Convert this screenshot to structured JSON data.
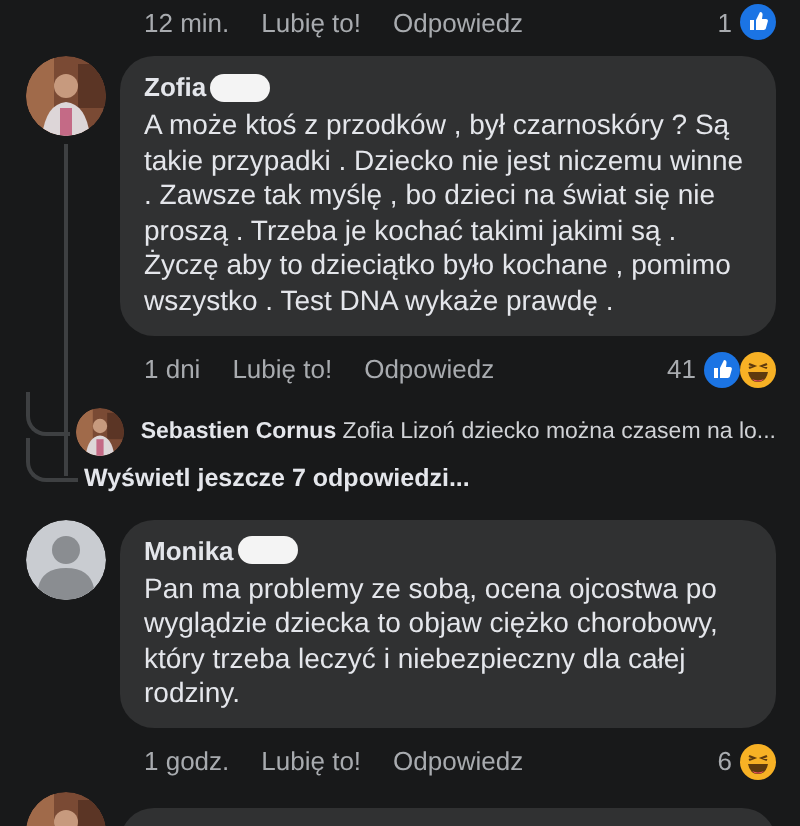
{
  "previous_comment": {
    "time": "12 min.",
    "like": "Lubię to!",
    "reply": "Odpowiedz",
    "reaction_count": "1",
    "reactions": [
      {
        "kind": "like"
      }
    ]
  },
  "comments": [
    {
      "author": "Zofia",
      "name_redacted": true,
      "avatar": {
        "kind": "picture"
      },
      "text": "A może ktoś z przodków , był czarnoskóry ? Są takie przypadki . Dziecko nie jest niczemu winne . Zawsze tak myślę , bo dzieci na świat się nie proszą . Trzeba je kochać takimi jakimi są . Życzę aby to dzieciątko było kochane , pomimo wszystko . Test DNA wykaże prawdę .",
      "time": "1 dni",
      "like": "Lubię to!",
      "reply": "Odpowiedz",
      "reaction_count": "41",
      "reactions": [
        {
          "kind": "like"
        },
        {
          "kind": "haha"
        }
      ],
      "replies": [
        {
          "author": "Sebastien Cornus",
          "avatar": {
            "kind": "picture"
          },
          "text": "Zofia Lizoń dziecko można czasem na lo..."
        }
      ],
      "more_replies": "Wyświetl jeszcze 7 odpowiedzi..."
    },
    {
      "author": "Monika",
      "name_redacted": true,
      "avatar": {
        "kind": "default"
      },
      "text": "Pan ma problemy ze sobą,  ocena ojcostwa po wyglądzie dziecka  to objaw ciężko chorobowy, który trzeba leczyć  i niebezpieczny dla całej rodziny.",
      "time": "1 godz.",
      "like": "Lubię to!",
      "reply": "Odpowiedz",
      "reaction_count": "6",
      "reactions": [
        {
          "kind": "haha"
        }
      ]
    }
  ],
  "next_comment": {
    "avatar": {
      "kind": "picture"
    }
  }
}
